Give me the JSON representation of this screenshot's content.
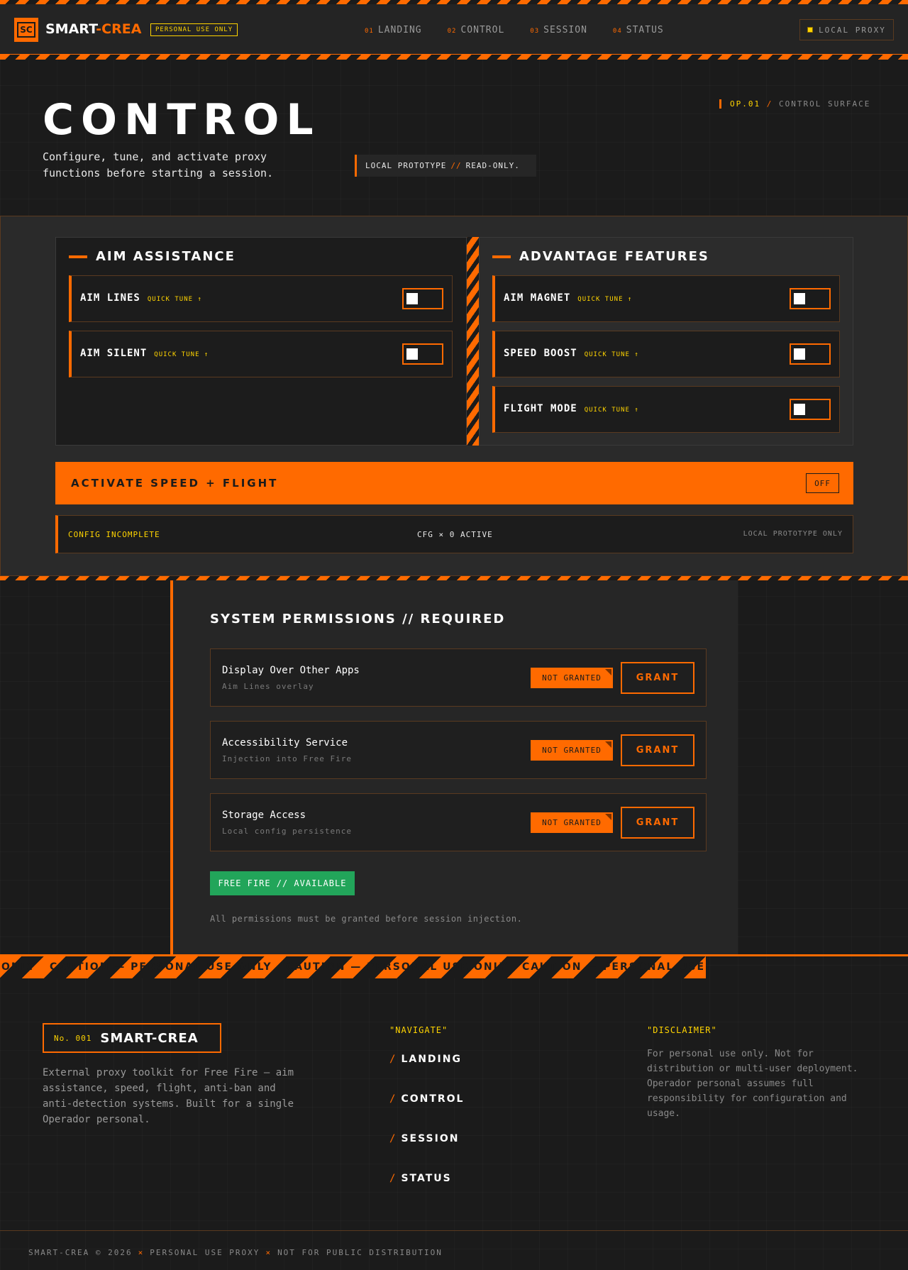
{
  "header": {
    "logo_mark": "SC",
    "brand_primary": "SMART",
    "brand_accent": "-CREA",
    "badge": "PERSONAL USE ONLY",
    "nav": [
      {
        "num": "01",
        "label": "LANDING"
      },
      {
        "num": "02",
        "label": "CONTROL"
      },
      {
        "num": "03",
        "label": "SESSION"
      },
      {
        "num": "04",
        "label": "STATUS"
      }
    ],
    "proxy_label": "LOCAL PROXY"
  },
  "hero": {
    "title": "CONTROL",
    "subtitle": "Configure, tune, and activate proxy functions before starting a session.",
    "op_code": "OP.01",
    "op_sep": "/",
    "op_label": "CONTROL SURFACE",
    "proto_a": "LOCAL PROTOTYPE",
    "proto_sep": "//",
    "proto_b": "READ-ONLY."
  },
  "control": {
    "aim": {
      "title": "AIM ASSISTANCE",
      "items": [
        {
          "name": "AIM LINES",
          "tune": "QUICK TUNE ↑",
          "enabled": false
        },
        {
          "name": "AIM SILENT",
          "tune": "QUICK TUNE ↑",
          "enabled": false
        }
      ]
    },
    "advantage": {
      "title": "ADVANTAGE FEATURES",
      "items": [
        {
          "name": "AIM MAGNET",
          "tune": "QUICK TUNE ↑",
          "enabled": false
        },
        {
          "name": "SPEED BOOST",
          "tune": "QUICK TUNE ↑",
          "enabled": false
        },
        {
          "name": "FLIGHT MODE",
          "tune": "QUICK TUNE ↑",
          "enabled": false
        }
      ]
    },
    "activate_label": "ACTIVATE SPEED + FLIGHT",
    "activate_state": "OFF",
    "status": {
      "left": "CONFIG INCOMPLETE",
      "center": "CFG × 0 ACTIVE",
      "right": "LOCAL PROTOTYPE ONLY"
    }
  },
  "permissions": {
    "title": "SYSTEM PERMISSIONS // REQUIRED",
    "items": [
      {
        "name": "Display Over Other Apps",
        "desc": "Aim Lines overlay",
        "state": "NOT GRANTED",
        "action": "GRANT"
      },
      {
        "name": "Accessibility Service",
        "desc": "Injection into Free Fire",
        "state": "NOT GRANTED",
        "action": "GRANT"
      },
      {
        "name": "Storage Access",
        "desc": "Local config persistence",
        "state": "NOT GRANTED",
        "action": "GRANT"
      }
    ],
    "game_status": "FREE FIRE // AVAILABLE",
    "note": "All permissions must be granted before session injection."
  },
  "caution": {
    "text": "CAUTION — PERSONAL USE ONLY"
  },
  "footer": {
    "badge_no": "No. 001",
    "badge_name": "SMART-CREA",
    "description": "External proxy toolkit for Free Fire — aim assistance, speed, flight, anti-ban and anti-detection systems. Built for a single Operador personal.",
    "nav_heading": "\"NAVIGATE\"",
    "nav": [
      "LANDING",
      "CONTROL",
      "SESSION",
      "STATUS"
    ],
    "disclaimer_heading": "\"DISCLAIMER\"",
    "disclaimer": "For personal use only. Not for distribution or multi-user deployment. Operador personal assumes full responsibility for configuration and usage.",
    "copyright": [
      "SMART-CREA © 2026",
      "PERSONAL USE PROXY",
      "NOT FOR PUBLIC DISTRIBUTION"
    ]
  },
  "colors": {
    "accent": "#ff6a00",
    "highlight": "#ffd400",
    "success": "#22a55a",
    "background": "#1b1b1b"
  }
}
